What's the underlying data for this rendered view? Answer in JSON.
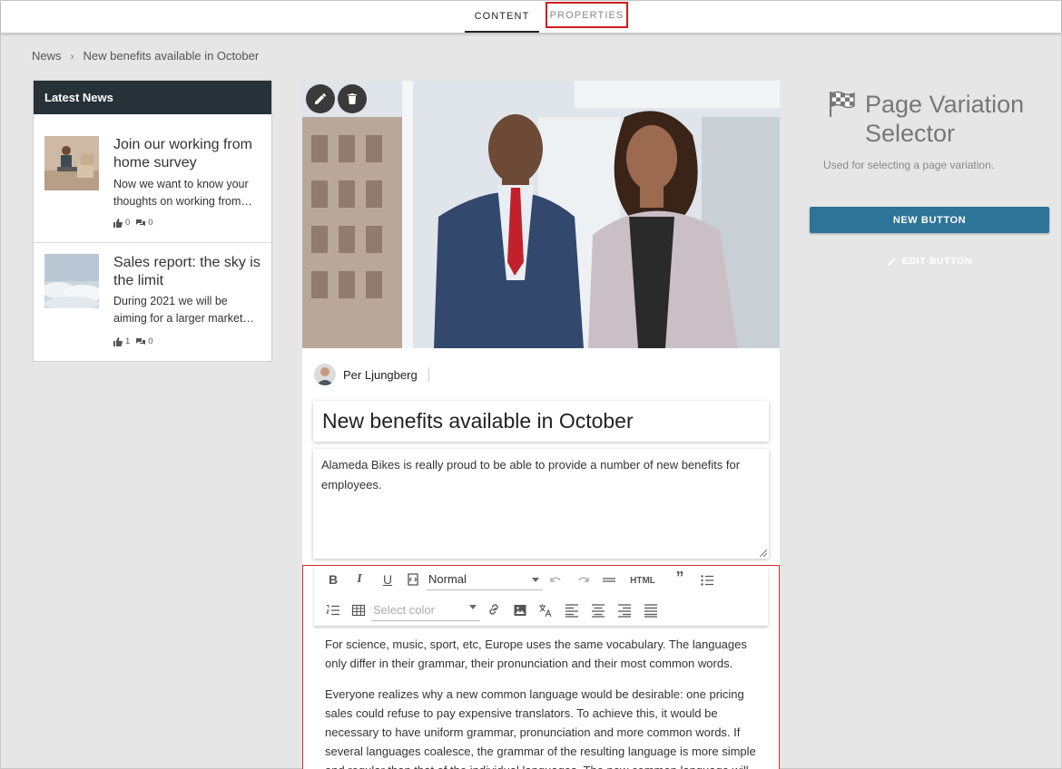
{
  "tabs": [
    {
      "label": "CONTENT",
      "active": true
    },
    {
      "label": "PROPERTIES",
      "active": false
    }
  ],
  "breadcrumb": {
    "root": "News",
    "separator": "›",
    "current": "New benefits available in October"
  },
  "latest_news": {
    "title": "Latest News",
    "items": [
      {
        "title": "Join our working from home survey",
        "excerpt_lines": [
          "Now we want to know your",
          "thoughts on working from…"
        ],
        "likes": "0",
        "comments": "0"
      },
      {
        "title": "Sales report: the sky is the limit",
        "excerpt_lines": [
          "During 2021 we will be",
          "aiming for a larger market…"
        ],
        "likes": "1",
        "comments": "0"
      }
    ]
  },
  "article": {
    "author": "Per Ljungberg",
    "title": "New benefits available in October",
    "summary": "Alameda Bikes is really proud to be able to provide a number of new benefits for employees.",
    "editor": {
      "format_select": "Normal",
      "color_placeholder": "Select color",
      "html_label": "HTML",
      "paragraphs": [
        "For science, music, sport, etc, Europe uses the same vocabulary. The languages only differ in their grammar, their pronunciation and their most common words.",
        "Everyone realizes why a new common language would be desirable: one pricing sales could refuse to pay expensive translators. To achieve this, it would be necessary to have uniform grammar, pronunciation and more common words. If several languages coalesce, the grammar of the resulting language is more simple and regular than that of the individual languages. The new common language will"
      ]
    }
  },
  "page_variation": {
    "title": "Page Variation Selector",
    "description": "Used for selecting a page variation.",
    "new_button": "NEW BUTTON",
    "edit_button": "EDIT BUTTON"
  },
  "colors": {
    "header_dark": "#263138",
    "accent_button": "#2e7499",
    "highlight_border": "#d32f2f",
    "background": "#e6e6e6"
  }
}
